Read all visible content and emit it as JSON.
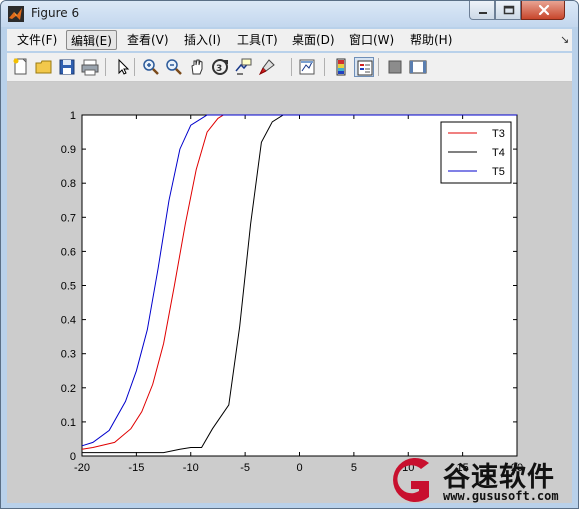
{
  "window": {
    "title": "Figure 6"
  },
  "menu": [
    "文件(F)",
    "编辑(E)",
    "查看(V)",
    "插入(I)",
    "工具(T)",
    "桌面(D)",
    "窗口(W)",
    "帮助(H)"
  ],
  "menu_active_index": 1,
  "toolbar": [
    "new-figure-icon",
    "open-icon",
    "save-icon",
    "print-icon",
    "pointer-icon",
    "zoom-in-icon",
    "zoom-out-icon",
    "pan-icon",
    "rotate-3d-icon",
    "data-cursor-icon",
    "brush-icon",
    "link-plot-icon",
    "colorbar-icon",
    "legend-icon",
    "hide-plot-tools-icon",
    "show-plot-tools-icon"
  ],
  "watermark": {
    "text": "谷速软件",
    "url": "www.gususoft.com",
    "color": "#c8102e"
  },
  "chart_data": {
    "type": "line",
    "xlim": [
      -20,
      20
    ],
    "ylim": [
      0,
      1
    ],
    "xticks": [
      -20,
      -15,
      -10,
      -5,
      0,
      5,
      10,
      15,
      20
    ],
    "yticks": [
      0,
      0.1,
      0.2,
      0.3,
      0.4,
      0.5,
      0.6,
      0.7,
      0.8,
      0.9,
      1
    ],
    "grid": false,
    "legend_position": "top-right",
    "series": [
      {
        "name": "T3",
        "color": "#e00000",
        "x": [
          -20,
          -19,
          -17,
          -15.5,
          -14.5,
          -13.5,
          -12.5,
          -11.5,
          -10.5,
          -9.5,
          -8.5,
          -7.5,
          -7,
          -6,
          20
        ],
        "y": [
          0.02,
          0.025,
          0.04,
          0.08,
          0.13,
          0.21,
          0.33,
          0.5,
          0.68,
          0.84,
          0.95,
          0.99,
          1,
          1,
          1
        ]
      },
      {
        "name": "T4",
        "color": "#000000",
        "x": [
          -20,
          -15,
          -12.5,
          -11,
          -10,
          -9,
          -8,
          -6.5,
          -5.5,
          -4.5,
          -3.5,
          -2.5,
          -1.5,
          -1,
          20
        ],
        "y": [
          0.01,
          0.01,
          0.01,
          0.02,
          0.025,
          0.025,
          0.08,
          0.15,
          0.38,
          0.68,
          0.92,
          0.98,
          1,
          1,
          1
        ]
      },
      {
        "name": "T5",
        "color": "#0000cc",
        "x": [
          -20,
          -19,
          -17.5,
          -16,
          -15,
          -14,
          -13,
          -12,
          -11,
          -10,
          -9,
          -8.5,
          -7.5,
          20
        ],
        "y": [
          0.03,
          0.04,
          0.075,
          0.16,
          0.25,
          0.37,
          0.55,
          0.75,
          0.9,
          0.97,
          0.99,
          1,
          1,
          1
        ]
      }
    ]
  }
}
